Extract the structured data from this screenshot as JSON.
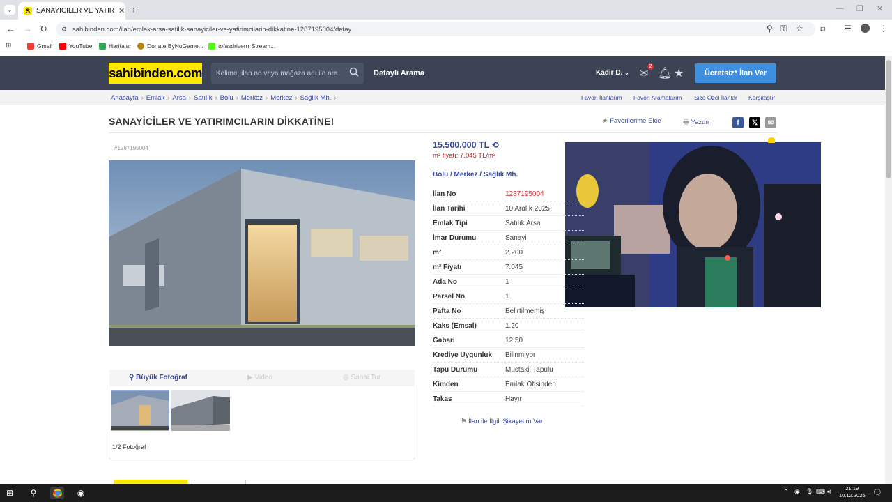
{
  "browser": {
    "tab_title": "SANAYİCİLER VE YATIRIMCILAR",
    "url": "sahibinden.com/ilan/emlak-arsa-satilik-sanayiciler-ve-yatirimcilarin-dikkatine-1287195004/detay",
    "bookmarks": [
      "Gmail",
      "YouTube",
      "Haritalar",
      "Donate ByNoGame...",
      "tofasdriverrr Stream..."
    ]
  },
  "site": {
    "logo": "sahibinden.com",
    "search_placeholder": "Kelime, ilan no veya mağaza adı ile ara",
    "detailed_search": "Detaylı Arama",
    "user": "Kadir D.",
    "message_count": "2",
    "cta": "Ücretsiz* İlan Ver",
    "breadcrumbs": [
      "Anasayfa",
      "Emlak",
      "Arsa",
      "Satılık",
      "Bolu",
      "Merkez",
      "Merkez",
      "Sağlık Mh."
    ],
    "right_links": [
      "Favori İlanlarım",
      "Favori Aramalarım",
      "Size Özel İlanlar",
      "Karşılaştır"
    ]
  },
  "listing": {
    "title": "SANAYİCİLER VE YATIRIMCILARIN DİKKATİNE!",
    "add_favorite": "Favorilerime Ekle",
    "print": "Yazdır",
    "id_label": "#1287195004",
    "price": "15.500.000 TL",
    "m2_price": "m² fiyatı: 7.045 TL/m²",
    "location": "Bolu  /  Merkez  /  Sağlık Mh.",
    "specs": [
      {
        "k": "İlan No",
        "v": "1287195004"
      },
      {
        "k": "İlan Tarihi",
        "v": "10 Aralık 2025"
      },
      {
        "k": "Emlak Tipi",
        "v": "Satılık Arsa"
      },
      {
        "k": "İmar Durumu",
        "v": "Sanayi"
      },
      {
        "k": "m²",
        "v": "2.200"
      },
      {
        "k": "m² Fiyatı",
        "v": "7.045"
      },
      {
        "k": "Ada No",
        "v": "1"
      },
      {
        "k": "Parsel No",
        "v": "1"
      },
      {
        "k": "Pafta No",
        "v": "Belirtilmemiş"
      },
      {
        "k": "Kaks (Emsal)",
        "v": "1.20"
      },
      {
        "k": "Gabari",
        "v": "12.50"
      },
      {
        "k": "Krediye Uygunluk",
        "v": "Bilinmiyor"
      },
      {
        "k": "Tapu Durumu",
        "v": "Müstakil Tapulu"
      },
      {
        "k": "Kimden",
        "v": "Emlak Ofisinden"
      },
      {
        "k": "Takas",
        "v": "Hayır"
      }
    ],
    "complaint": "İlan ile İlgili Şikayetim Var",
    "media_tabs": {
      "photo": "Büyük Fotoğraf",
      "video": "Video",
      "tour": "Sanal Tur"
    },
    "photo_count": "1/2 Fotoğraf"
  },
  "taskbar": {
    "time": "21:19",
    "date": "10.12.2025"
  }
}
